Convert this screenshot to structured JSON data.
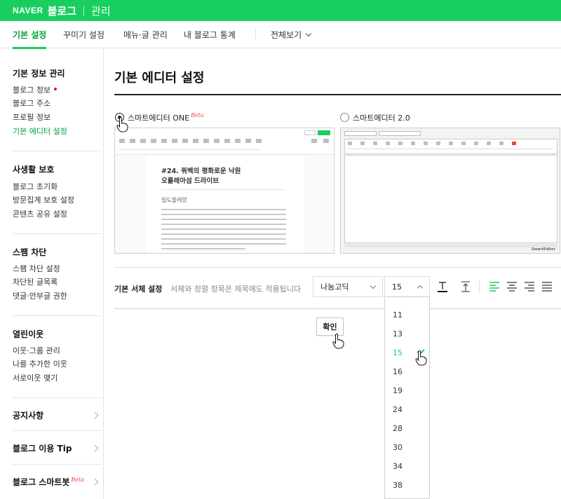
{
  "header": {
    "brand": "NAVER",
    "app": "블로그",
    "page": "관리"
  },
  "tabs": [
    {
      "label": "기본 설정",
      "active": true
    },
    {
      "label": "꾸미기 설정"
    },
    {
      "label": "메뉴·글 관리"
    },
    {
      "label": "내 블로그 통계"
    },
    {
      "label": "전체보기"
    }
  ],
  "sidebar": {
    "basic": {
      "title": "기본 정보 관리",
      "items": [
        "블로그 정보",
        "블로그 주소",
        "프로필 정보",
        "기본 에디터 설정"
      ]
    },
    "privacy": {
      "title": "사생활 보호",
      "items": [
        "블로그 초기화",
        "방문집계 보호 설정",
        "콘텐츠 공유 설정"
      ]
    },
    "spam": {
      "title": "스팸 차단",
      "items": [
        "스팸 차단 설정",
        "차단된 글목록",
        "댓글·안부글 권한"
      ]
    },
    "neighbors": {
      "title": "열린이웃",
      "items": [
        "이웃·그룹 관리",
        "나를 추가한 이웃",
        "서로이웃 맺기"
      ]
    },
    "links": [
      "공지사항",
      "블로그 이용 Tip",
      "블로그 스마트봇"
    ],
    "beta_label": "Beta"
  },
  "main": {
    "title": "기본 에디터 설정",
    "editors": [
      {
        "label": "스마트에디터 ONE",
        "beta": "Beta",
        "selected": true
      },
      {
        "label": "스마트에디터 2.0",
        "selected": false
      }
    ],
    "preview_one": {
      "post_title_1": "#24. 쿼벡의 평화로운 낙원",
      "post_title_2": "오를레아섬 드라이브",
      "subheading": "일도올레앙"
    },
    "preview_two": {
      "brand": "SmartEditor"
    },
    "font": {
      "label": "기본 서체 설정",
      "description": "서체와 정렬 항목은 제목에도 적용됩니다",
      "family": "나눔고딕",
      "size": "15",
      "size_options": [
        "11",
        "13",
        "15",
        "16",
        "19",
        "24",
        "28",
        "30",
        "34",
        "38"
      ]
    },
    "confirm_label": "확인"
  },
  "colors": {
    "brand_green": "#19ce60",
    "active_text": "#00a33b",
    "beta_red": "#ff3b3b"
  }
}
